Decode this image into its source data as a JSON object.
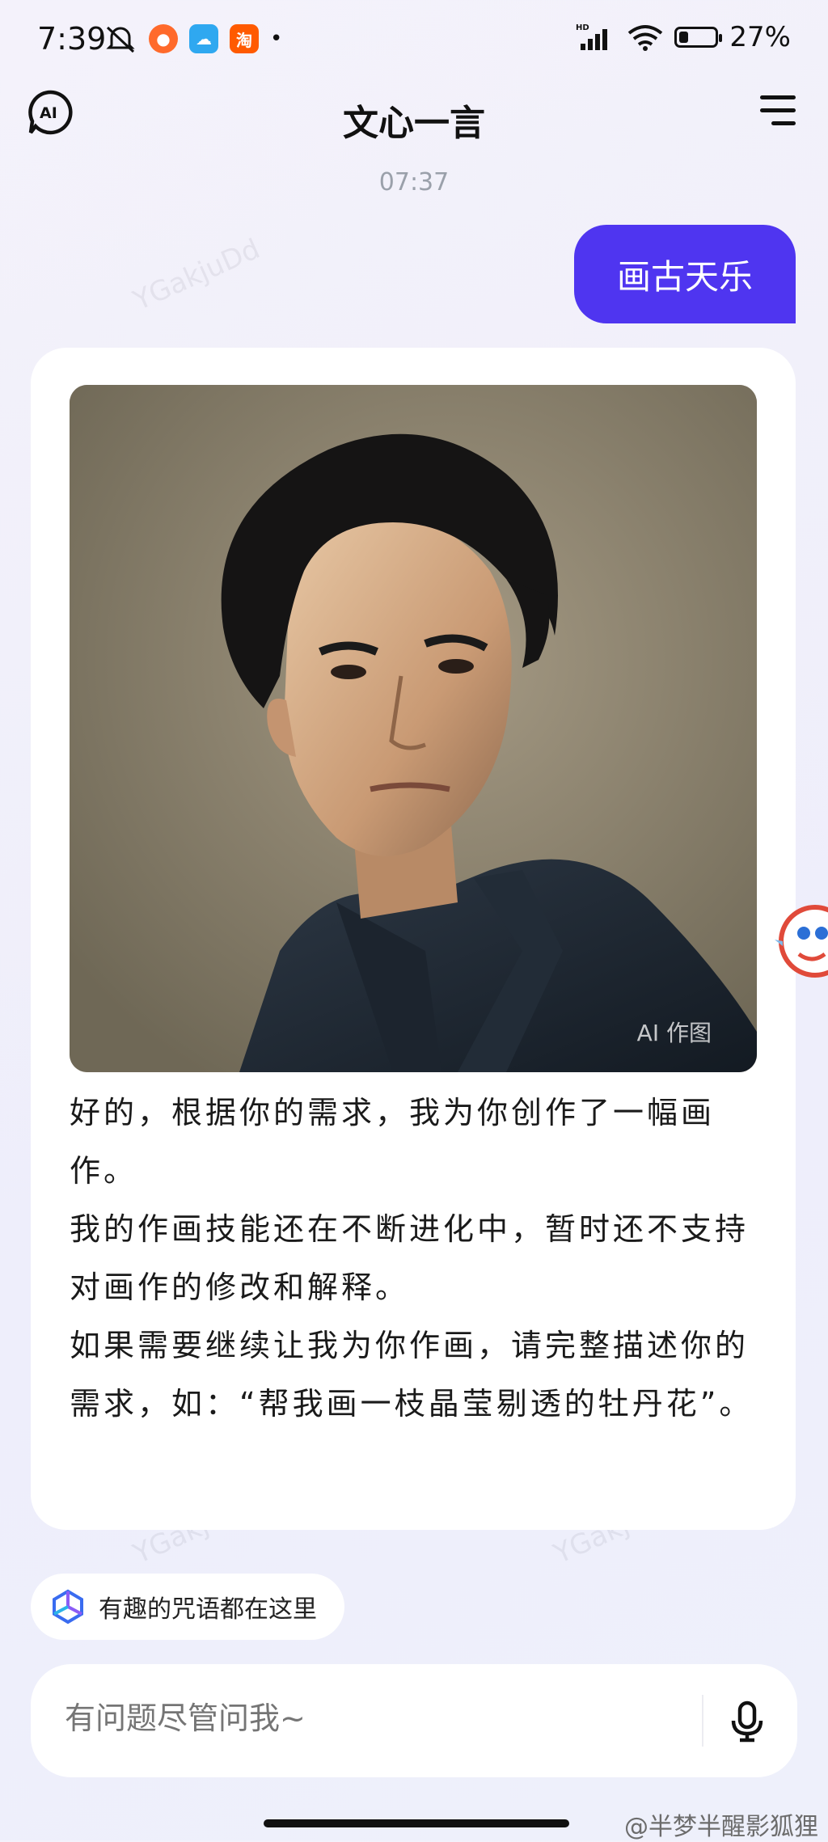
{
  "status_bar": {
    "time": "7:39",
    "apps": [
      "淘"
    ],
    "network": "HD",
    "battery_percent": "27%",
    "battery_level": 0.27
  },
  "header": {
    "title": "文心一言",
    "logo_icon": "ai-logo-icon",
    "menu_icon": "menu-icon"
  },
  "chat": {
    "timestamp": "07:37",
    "user_message": "画古天乐",
    "bot": {
      "image_badge": "AI 作图",
      "paragraphs": [
        "好的，根据你的需求，我为你创作了一幅画作。",
        "我的作画技能还在不断进化中，暂时还不支持对画作的修改和解释。",
        "如果需要继续让我为你作画，请完整描述你的需求，如：“帮我画一枝晶莹剔透的牡丹花”。"
      ]
    }
  },
  "suggestion_chip": {
    "label": "有趣的咒语都在这里"
  },
  "input": {
    "placeholder": "有问题尽管问我~"
  },
  "footer": {
    "watermark": "@半梦半醒影狐狸"
  },
  "watermark_text": "YGakjuDd",
  "colors": {
    "accent": "#4f35f0",
    "card_bg": "#ffffff",
    "page_bg": "#f1f0fa"
  }
}
